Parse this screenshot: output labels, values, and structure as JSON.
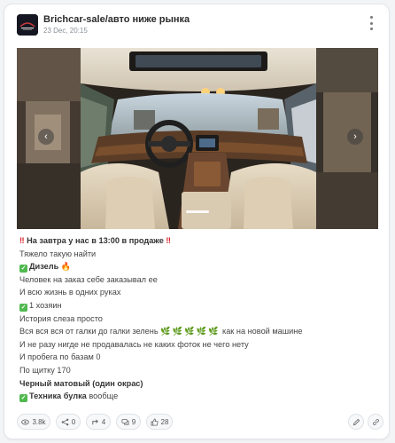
{
  "header": {
    "channel_title": "Brichcar-sale/авто ниже рынка",
    "date": "23 Dec, 20:15"
  },
  "gallery": {
    "prev_icon": "chevron-left-icon",
    "next_icon": "chevron-right-icon",
    "prev_glyph": "‹",
    "next_glyph": "›"
  },
  "post": {
    "l1": "На завтра у нас в 13:00 в продаже",
    "l2": "Тяжело такую найти",
    "l3": "Дизель",
    "l4": "Человек на заказ себе заказывал ее",
    "l5": "И всю жизнь в одних руках",
    "l6": "1 хозяин",
    "l7": "История слеза просто",
    "l8a": "Вся вся вся от галки до галки зелень",
    "l8b": "как на новой машине",
    "l9": "И не разу нигде не продавалась не каких фоток не чего нету",
    "l10": "И пробега по базам 0",
    "l11": "По щитку 170",
    "l12": "Черный матовый (один окрас)",
    "l13a": "Техника булка",
    "l13b": "вообще"
  },
  "footer": {
    "views": "3.8k",
    "shares": "0",
    "forwards": "4",
    "comments": "9",
    "likes": "28"
  },
  "colors": {
    "accent_green": "#4fb94f",
    "alert_red": "#d8232a"
  }
}
